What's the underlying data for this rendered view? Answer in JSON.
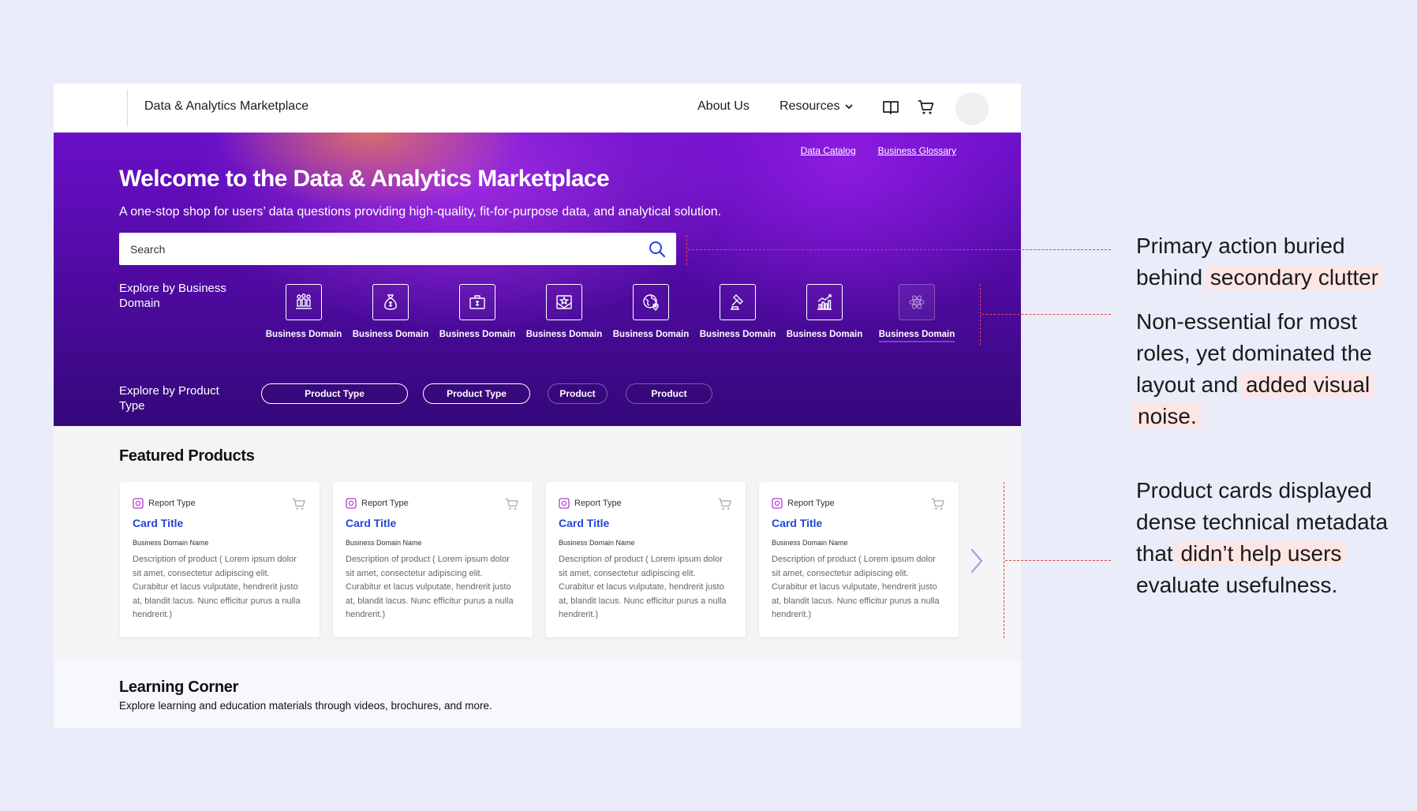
{
  "topbar": {
    "brand": "Data & Analytics Marketplace",
    "nav": {
      "about": "About Us",
      "resources": "Resources"
    }
  },
  "hero": {
    "links": {
      "catalog": "Data Catalog",
      "glossary": "Business Glossary"
    },
    "title": "Welcome to the Data & Analytics Marketplace",
    "subtitle": "A one-stop shop for users’ data questions providing high-quality, fit-for-purpose data, and analytical solution.",
    "search": {
      "placeholder": "Search",
      "value": ""
    },
    "explore_domain_label": "Explore by Business Domain",
    "explore_product_label": "Explore by Product Type",
    "domains": [
      {
        "label": "Business Domain",
        "icon": "people-chart-icon"
      },
      {
        "label": "Business Domain",
        "icon": "money-bag-icon"
      },
      {
        "label": "Business Domain",
        "icon": "briefcase-icon"
      },
      {
        "label": "Business Domain",
        "icon": "badge-envelope-icon"
      },
      {
        "label": "Business Domain",
        "icon": "globe-pin-icon"
      },
      {
        "label": "Business Domain",
        "icon": "gavel-icon"
      },
      {
        "label": "Business Domain",
        "icon": "bar-chart-icon"
      },
      {
        "label": "Business Domain",
        "icon": "atom-icon"
      }
    ],
    "product_types": [
      "Product Type",
      "Product Type",
      "Product",
      "Product"
    ]
  },
  "featured": {
    "title": "Featured Products",
    "cards": [
      {
        "type": "Report Type",
        "title": "Card Title",
        "domain": "Business Domain Name",
        "description": "Description of product ( Lorem ipsum dolor sit amet, consectetur adipiscing elit. Curabitur et lacus vulputate, hendrerit justo at, blandit lacus. Nunc efficitur purus a nulla hendrerit.)"
      },
      {
        "type": "Report Type",
        "title": "Card Title",
        "domain": "Business Domain Name",
        "description": "Description of product ( Lorem ipsum dolor sit amet, consectetur adipiscing elit. Curabitur et lacus vulputate, hendrerit justo at, blandit lacus. Nunc efficitur purus a nulla hendrerit.)"
      },
      {
        "type": "Report Type",
        "title": "Card Title",
        "domain": "Business Domain Name",
        "description": "Description of product ( Lorem ipsum dolor sit amet, consectetur adipiscing elit. Curabitur et lacus vulputate, hendrerit justo at, blandit lacus. Nunc efficitur purus a nulla hendrerit.)"
      },
      {
        "type": "Report Type",
        "title": "Card Title",
        "domain": "Business Domain Name",
        "description": "Description of product ( Lorem ipsum dolor sit amet, consectetur adipiscing elit. Curabitur et lacus vulputate, hendrerit justo at, blandit lacus. Nunc efficitur purus a nulla hendrerit.)"
      }
    ]
  },
  "learning": {
    "title": "Learning Corner",
    "description": "Explore learning and education materials through videos, brochures, and more."
  },
  "annotations": {
    "note1": {
      "a": "Primary action buried behind",
      "b": "secondary clutter"
    },
    "note2": {
      "a": "Non-essential for most roles, yet dominated the layout and",
      "b": "added visual",
      "c": "noise."
    },
    "note3": {
      "a": "Product cards displayed dense technical metadata that",
      "b": "didn’t help users",
      "c": "evaluate usefulness."
    }
  },
  "colors": {
    "accent": "#2346d8",
    "hero_dark": "#34087a",
    "annotation": "#e04646",
    "highlight": "#fde5e4"
  }
}
